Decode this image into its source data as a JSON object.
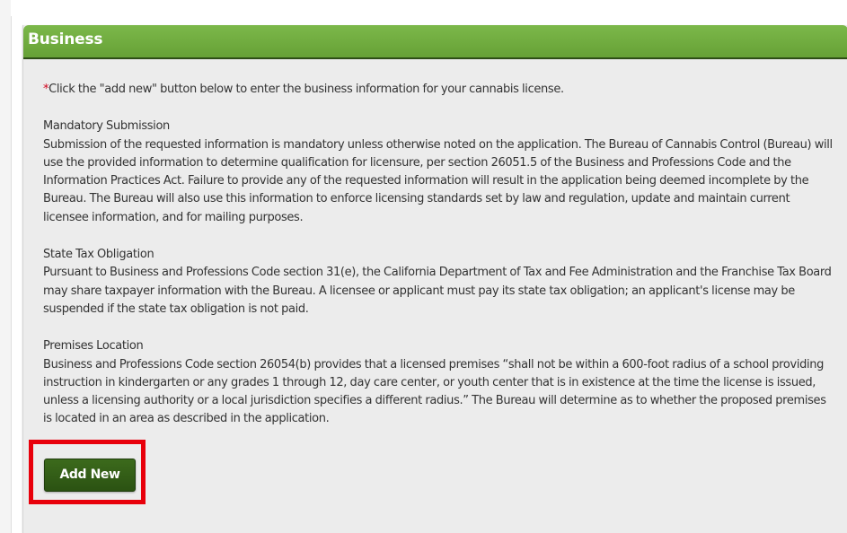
{
  "panel": {
    "title": "Business"
  },
  "intro": {
    "required_marker": "*",
    "text": "Click the \"add new\" button below to enter the business information for your cannabis license."
  },
  "sections": [
    {
      "heading": "Mandatory Submission",
      "text": "Submission of the requested information is mandatory unless otherwise noted on the application. The Bureau of Cannabis Control (Bureau) will use the provided information to determine qualification for licensure, per section 26051.5 of the Business and Professions Code and the Information Practices Act. Failure to provide any of the requested information will result in the application being deemed incomplete by the Bureau. The Bureau will also use this information to enforce licensing standards set by law and regulation, update and maintain current licensee information, and for mailing purposes."
    },
    {
      "heading": "State Tax Obligation",
      "text": "Pursuant to Business and Professions Code section 31(e), the California Department of Tax and Fee Administration and the Franchise Tax Board may share taxpayer information with the Bureau. A licensee or applicant must pay its state tax obligation; an applicant's license may be suspended if the state tax obligation is not paid."
    },
    {
      "heading": "Premises Location",
      "text": "Business and Professions Code section 26054(b) provides that a licensed premises “shall not be within a 600-foot radius of a school providing instruction in kindergarten or any grades 1 through 12, day care center, or youth center that is in existence at the time the license is issued, unless a licensing authority or a local jurisdiction specifies a different radius.” The Bureau will determine as to whether the proposed premises is located in an area as described in the application."
    }
  ],
  "actions": {
    "add_new_label": "Add New"
  },
  "colors": {
    "header_green": "#6eaa3e",
    "button_green": "#335f17",
    "highlight_red": "#e8000b",
    "required_red": "#d0021b"
  }
}
